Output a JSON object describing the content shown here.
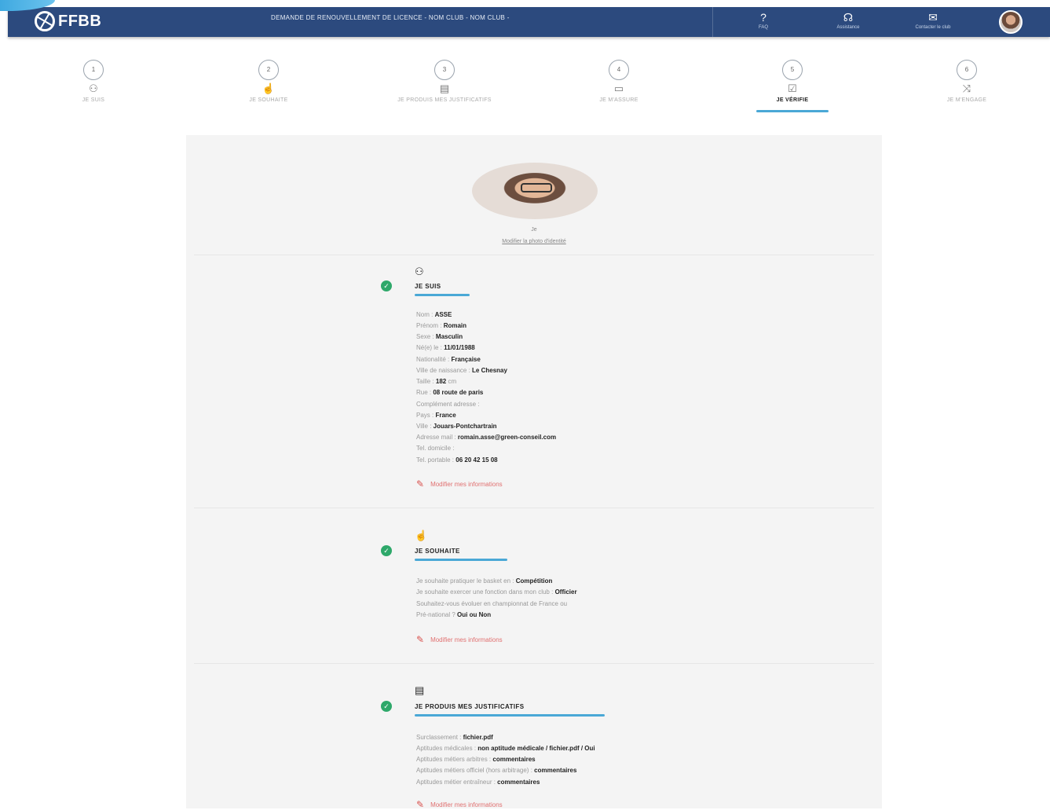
{
  "header": {
    "logo": "FFBB",
    "title": "DEMANDE DE RENOUVELLEMENT DE LICENCE - NOM CLUB - NOM CLUB -",
    "actions": [
      {
        "icon": "question-icon",
        "glyph": "?",
        "label": "FAQ"
      },
      {
        "icon": "headset-icon",
        "glyph": "☊",
        "label": "Assistance"
      },
      {
        "icon": "mail-icon",
        "glyph": "✉",
        "label": "Contacter le club"
      }
    ]
  },
  "steps": [
    {
      "num": "1",
      "icon": "user-icon",
      "glyph": "⚇",
      "label": "JE SUIS"
    },
    {
      "num": "2",
      "icon": "thumb-icon",
      "glyph": "☝",
      "label": "JE SOUHAITE"
    },
    {
      "num": "3",
      "icon": "document-icon",
      "glyph": "▤",
      "label": "JE PRODUIS MES JUSTIFICATIFS"
    },
    {
      "num": "4",
      "icon": "tablet-icon",
      "glyph": "▭",
      "label": "JE M'ASSURE"
    },
    {
      "num": "5",
      "icon": "check-doc-icon",
      "glyph": "☑",
      "label": "JE VÉRIFIE"
    },
    {
      "num": "6",
      "icon": "shuffle-icon",
      "glyph": "⤨",
      "label": "JE M'ENGAGE"
    }
  ],
  "profile": {
    "caption": "Je",
    "link": "Modifier la photo d'identité"
  },
  "sections": {
    "je_suis": {
      "title": "JE SUIS",
      "fields": [
        {
          "label": "Nom : ",
          "value": "ASSE"
        },
        {
          "label": "Prénom : ",
          "value": "Romain"
        },
        {
          "label": "Sexe : ",
          "value": "Masculin"
        },
        {
          "label": "Né(e) le : ",
          "value": "11/01/1988"
        },
        {
          "label": "Nationalité : ",
          "value": "Française"
        },
        {
          "label": "Ville de naissance : ",
          "value": "Le Chesnay"
        },
        {
          "label": "Taille : ",
          "value": "182",
          "suffix": " cm"
        },
        {
          "label": "Rue : ",
          "value": "08 route de paris"
        },
        {
          "label": "Complément adresse : ",
          "value": ""
        },
        {
          "label": "Pays : ",
          "value": "France"
        },
        {
          "label": "Ville : ",
          "value": "Jouars-Pontchartrain"
        },
        {
          "label": "Adresse mail : ",
          "value": "romain.asse@green-conseil.com"
        },
        {
          "label": "Tel. domicile : ",
          "value": ""
        },
        {
          "label": "Tel. portable : ",
          "value": "06 20 42 15 08"
        }
      ],
      "edit": "Modifier mes informations"
    },
    "je_souhaite": {
      "title": "JE SOUHAITE",
      "fields": [
        {
          "label": "Je souhaite pratiquer le basket en : ",
          "value": "Compétition"
        },
        {
          "label": "Je souhaite exercer une fonction dans mon club : ",
          "value": "Officier"
        },
        {
          "label": "Souhaitez-vous évoluer en championnat de France ou",
          "value": ""
        },
        {
          "label": "Pré-national ? ",
          "value": "Oui ou Non"
        }
      ],
      "edit": "Modifier mes informations"
    },
    "justificatifs": {
      "title": "JE PRODUIS MES JUSTIFICATIFS",
      "fields": [
        {
          "label": "Surclassement : ",
          "value": "fichier.pdf"
        },
        {
          "label": "Aptitudes médicales : ",
          "value": "non aptitude médicale / fichier.pdf / Oui"
        },
        {
          "label": "Aptitudes métiers arbitres : ",
          "value": "commentaires"
        },
        {
          "label": "Aptitudes métiers officiel (hors arbitrage) : ",
          "value": "commentaires"
        },
        {
          "label": "Aptitudes métier entraîneur : ",
          "value": "commentaires"
        }
      ],
      "edit": "Modifier mes informations"
    }
  },
  "colors": {
    "header_bg": "#2c4a7e",
    "accent": "#4aa8d6",
    "success": "#2ea86a",
    "edit": "#d9534f"
  }
}
